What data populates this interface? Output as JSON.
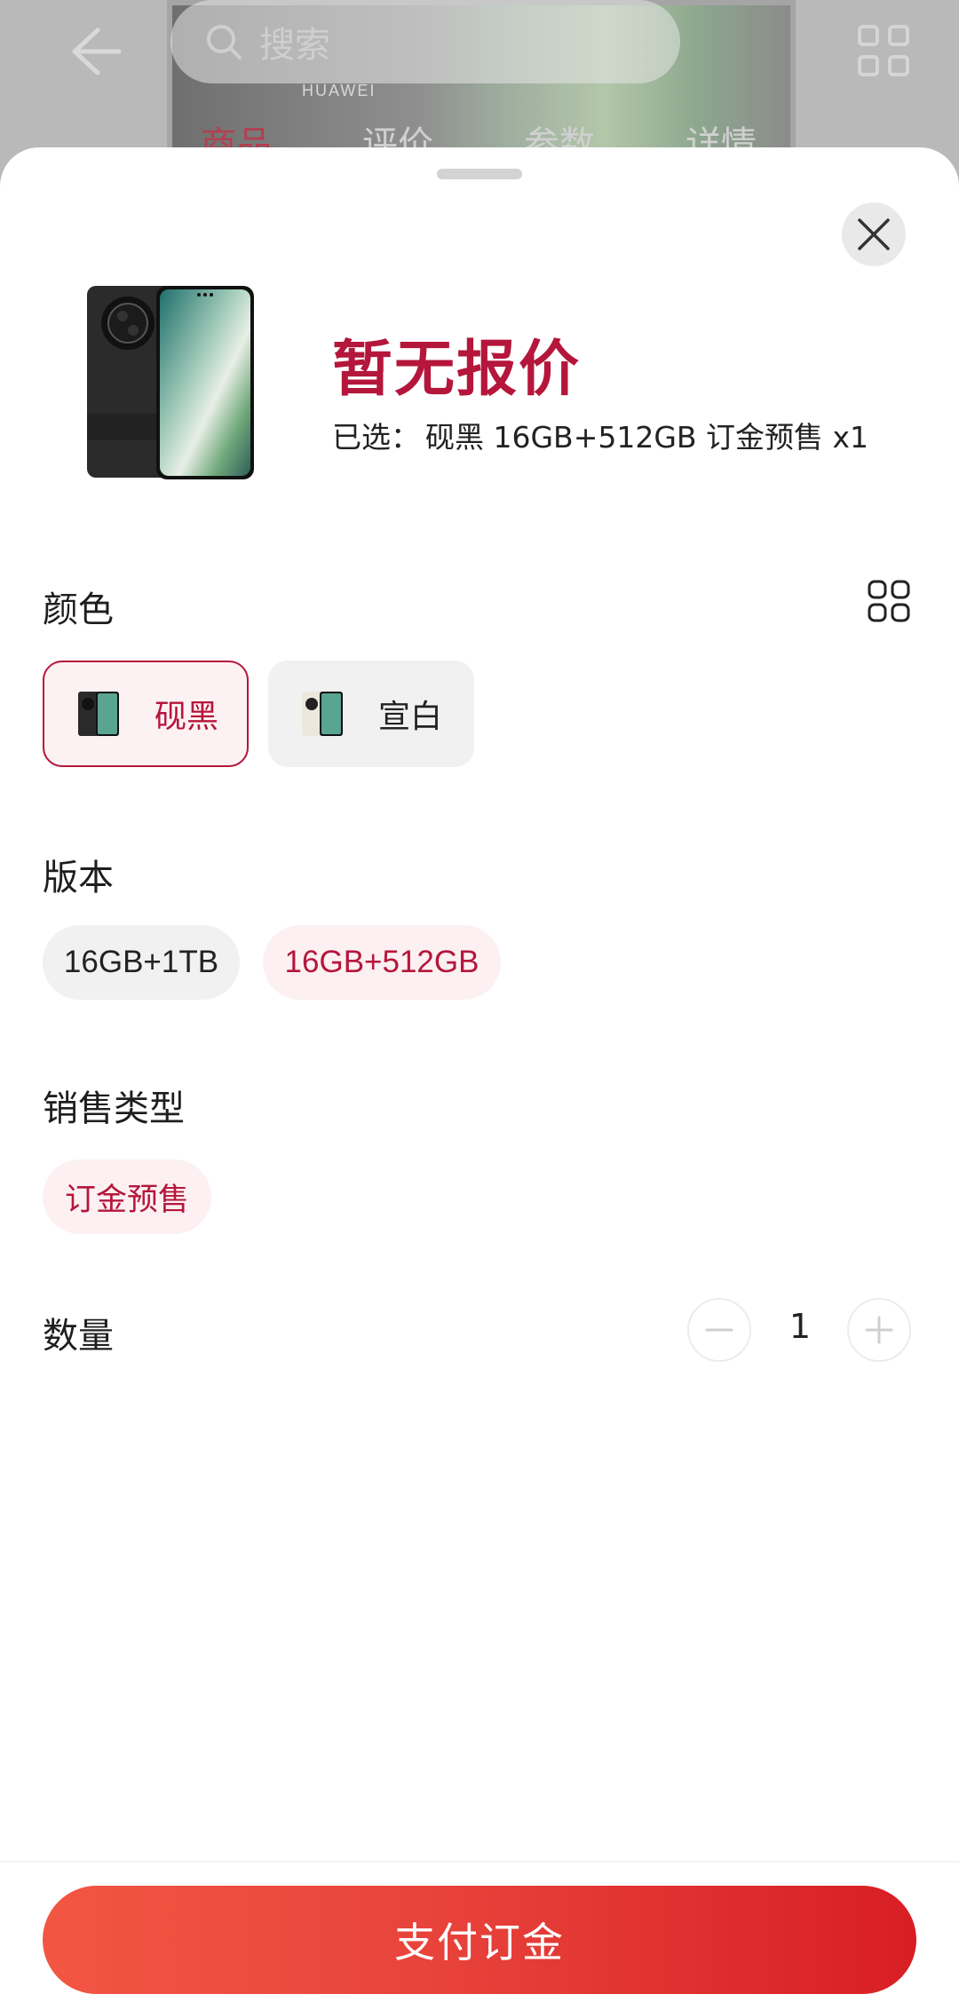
{
  "background": {
    "search_placeholder": "搜索",
    "brand": "HUAWEI",
    "tabs": [
      {
        "label": "商品",
        "active": true
      },
      {
        "label": "评价",
        "active": false
      },
      {
        "label": "参数",
        "active": false
      },
      {
        "label": "详情",
        "active": false
      }
    ]
  },
  "sheet": {
    "price": "暂无报价",
    "selected_label": "已选：",
    "selected_value": "砚黑 16GB+512GB 订金预售 x1",
    "color_section": {
      "title": "颜色",
      "options": [
        {
          "label": "砚黑",
          "selected": true
        },
        {
          "label": "宣白",
          "selected": false
        }
      ]
    },
    "version_section": {
      "title": "版本",
      "options": [
        {
          "label": "16GB+1TB",
          "selected": false
        },
        {
          "label": "16GB+512GB",
          "selected": true
        }
      ]
    },
    "sale_type_section": {
      "title": "销售类型",
      "options": [
        {
          "label": "订金预售",
          "selected": true
        }
      ]
    },
    "quantity_section": {
      "title": "数量",
      "value": "1"
    },
    "pay_button": "支付订金"
  },
  "colors": {
    "accent": "#b5163b",
    "pay_gradient_start": "#f25643",
    "pay_gradient_end": "#d81e24"
  }
}
